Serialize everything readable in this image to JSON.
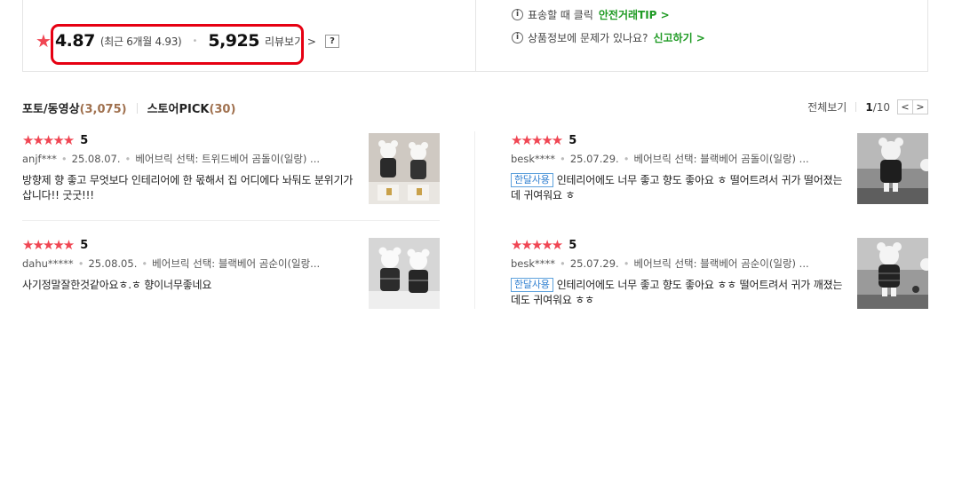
{
  "summary": {
    "average": "4.87",
    "recent_text": "(최근 6개월 4.93)",
    "separator": "•",
    "review_count": "5,925",
    "review_link": "리뷰보기 >",
    "help_label": "?"
  },
  "notices": {
    "top": {
      "text": "표송할 때 클릭",
      "link": "안전거래TIP >"
    },
    "bottom": {
      "text": "상품정보에 문제가 있나요?",
      "link": "신고하기 >"
    }
  },
  "tabs": [
    {
      "label": "포토/동영상",
      "count": "(3,075)"
    },
    {
      "label": "스토어PICK",
      "count": "(30)"
    }
  ],
  "pager": {
    "view_all": "전체보기",
    "current": "1",
    "total": "/10",
    "prev": "<",
    "next": ">"
  },
  "reviews": [
    {
      "stars": "★★★★★",
      "score": "5",
      "user": "anjf***",
      "date": "25.08.07.",
      "option": "베어브릭 선택: 트위드베어 곰돌이(일랑) ...",
      "badge": "",
      "text": "방향제 향 좋고 무엇보다 인테리어에 한 몫해서 집 어디에다 놔둬도 분위기가 삽니다!! 굿굿!!!"
    },
    {
      "stars": "★★★★★",
      "score": "5",
      "user": "besk****",
      "date": "25.07.29.",
      "option": "베어브릭 선택: 블랙베어 곰돌이(일랑) ...",
      "badge": "한달사용",
      "text": "인테리어에도 너무 좋고 향도 좋아요 ㅎ 떨어트려서 귀가 떨어졌는데 귀여워요 ㅎ"
    },
    {
      "stars": "★★★★★",
      "score": "5",
      "user": "dahu*****",
      "date": "25.08.05.",
      "option": "베어브릭 선택: 블랙베어 곰순이(일랑...",
      "badge": "",
      "text": "사기정말잘한것같아요ㅎ.ㅎ 향이너무좋네요"
    },
    {
      "stars": "★★★★★",
      "score": "5",
      "user": "besk****",
      "date": "25.07.29.",
      "option": "베어브릭 선택: 블랙베어 곰순이(일랑) ...",
      "badge": "한달사용",
      "text": "인테리어에도 너무 좋고 향도 좋아요 ㅎㅎ 떨어트려서 귀가 깨졌는데도 귀여워요 ㅎㅎ"
    }
  ],
  "colors": {
    "star": "#f04653",
    "highlight": "#e60012",
    "link_green": "#1e9a23",
    "tab_count": "#a0714f",
    "badge": "#2f7fd0"
  }
}
